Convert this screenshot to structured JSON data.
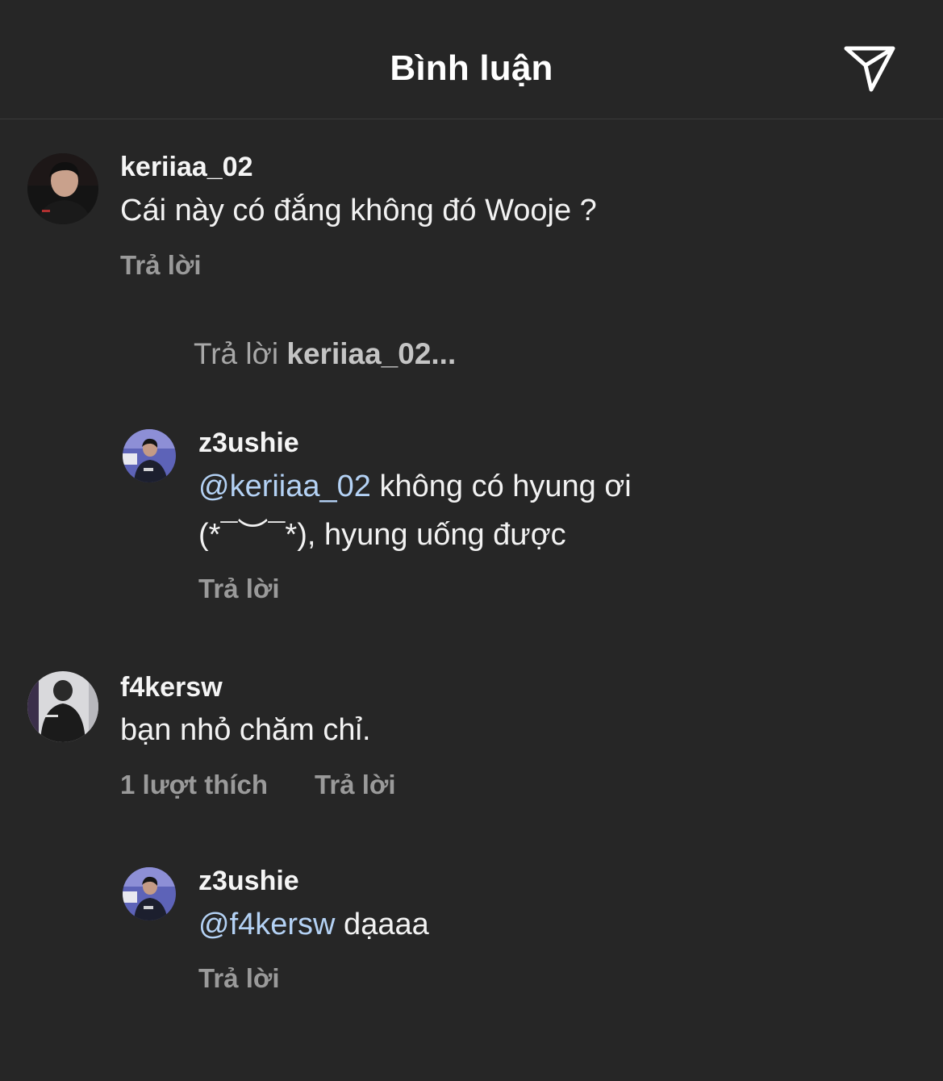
{
  "header": {
    "title": "Bình luận",
    "share_icon": "paper-plane-icon"
  },
  "comments": [
    {
      "username": "keriiaa_02",
      "text": "Cái này có đắng không đó Wooje ?",
      "reply_label": "Trả lời",
      "view_replies": {
        "prefix": "Trả lời ",
        "target": "keriiaa_02..."
      },
      "reply": {
        "username": "z3ushie",
        "mention": "@keriiaa_02",
        "text_line1": " không có hyung ơi",
        "text_line2": " (*¯︶¯*), hyung uống được",
        "reply_label": "Trả lời"
      }
    },
    {
      "username": "f4kersw",
      "text": "bạn nhỏ chăm chỉ.",
      "likes_label": "1 lượt thích",
      "reply_label": "Trả lời",
      "reply": {
        "username": "z3ushie",
        "mention": "@f4kersw",
        "text": " dạaaa",
        "reply_label": "Trả lời"
      }
    }
  ],
  "colors": {
    "background": "#262626",
    "mention": "#b4d2f5",
    "secondary_text": "#9a9a9a"
  }
}
